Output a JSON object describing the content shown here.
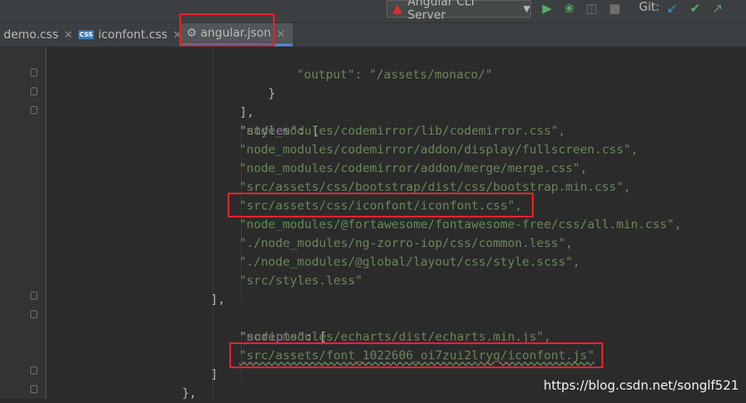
{
  "toolbar": {
    "run_config_label": "Angular CLI Server",
    "run_config_icon": "angular-icon",
    "icons": [
      "run-icon",
      "debug-icon",
      "coverage-icon",
      "stop-icon"
    ],
    "git_label": "Git:",
    "git_icons": [
      "git-update-icon",
      "git-commit-icon",
      "git-push-icon"
    ]
  },
  "tabs": [
    {
      "label": "demo.css",
      "active": false
    },
    {
      "label": "iconfont.css",
      "active": false,
      "icon": "CSS"
    },
    {
      "label": "angular.json",
      "active": true
    }
  ],
  "code": {
    "line1": "\"output\": \"/assets/monaco/\"",
    "line2": "}",
    "line3": "],",
    "styles_key": "\"styles\"",
    "styles_tail": ": [",
    "styles": [
      "\"node_modules/codemirror/lib/codemirror.css\",",
      "\"node_modules/codemirror/addon/display/fullscreen.css\",",
      "\"node_modules/codemirror/addon/merge/merge.css\",",
      "\"src/assets/css/bootstrap/dist/css/bootstrap.min.css\",",
      "\"src/assets/css/iconfont/iconfont.css\",",
      "\"node_modules/@fortawesome/fontawesome-free/css/all.min.css\",",
      "\"./node_modules/ng-zorro-iop/css/common.less\",",
      "\"./node_modules/@global/layout/css/style.scss\",",
      "\"src/styles.less\""
    ],
    "styles_close": "],",
    "scripts_key": "\"scripts\"",
    "scripts_tail": ": [",
    "scripts": [
      "\"node_modules/echarts/dist/echarts.min.js\",",
      "\"src/assets/font_1022606_oi7zui2lryg/iconfont.js\""
    ],
    "scripts_close": "]",
    "last_line": "},"
  },
  "watermark": "https://blog.csdn.net/songlf521"
}
